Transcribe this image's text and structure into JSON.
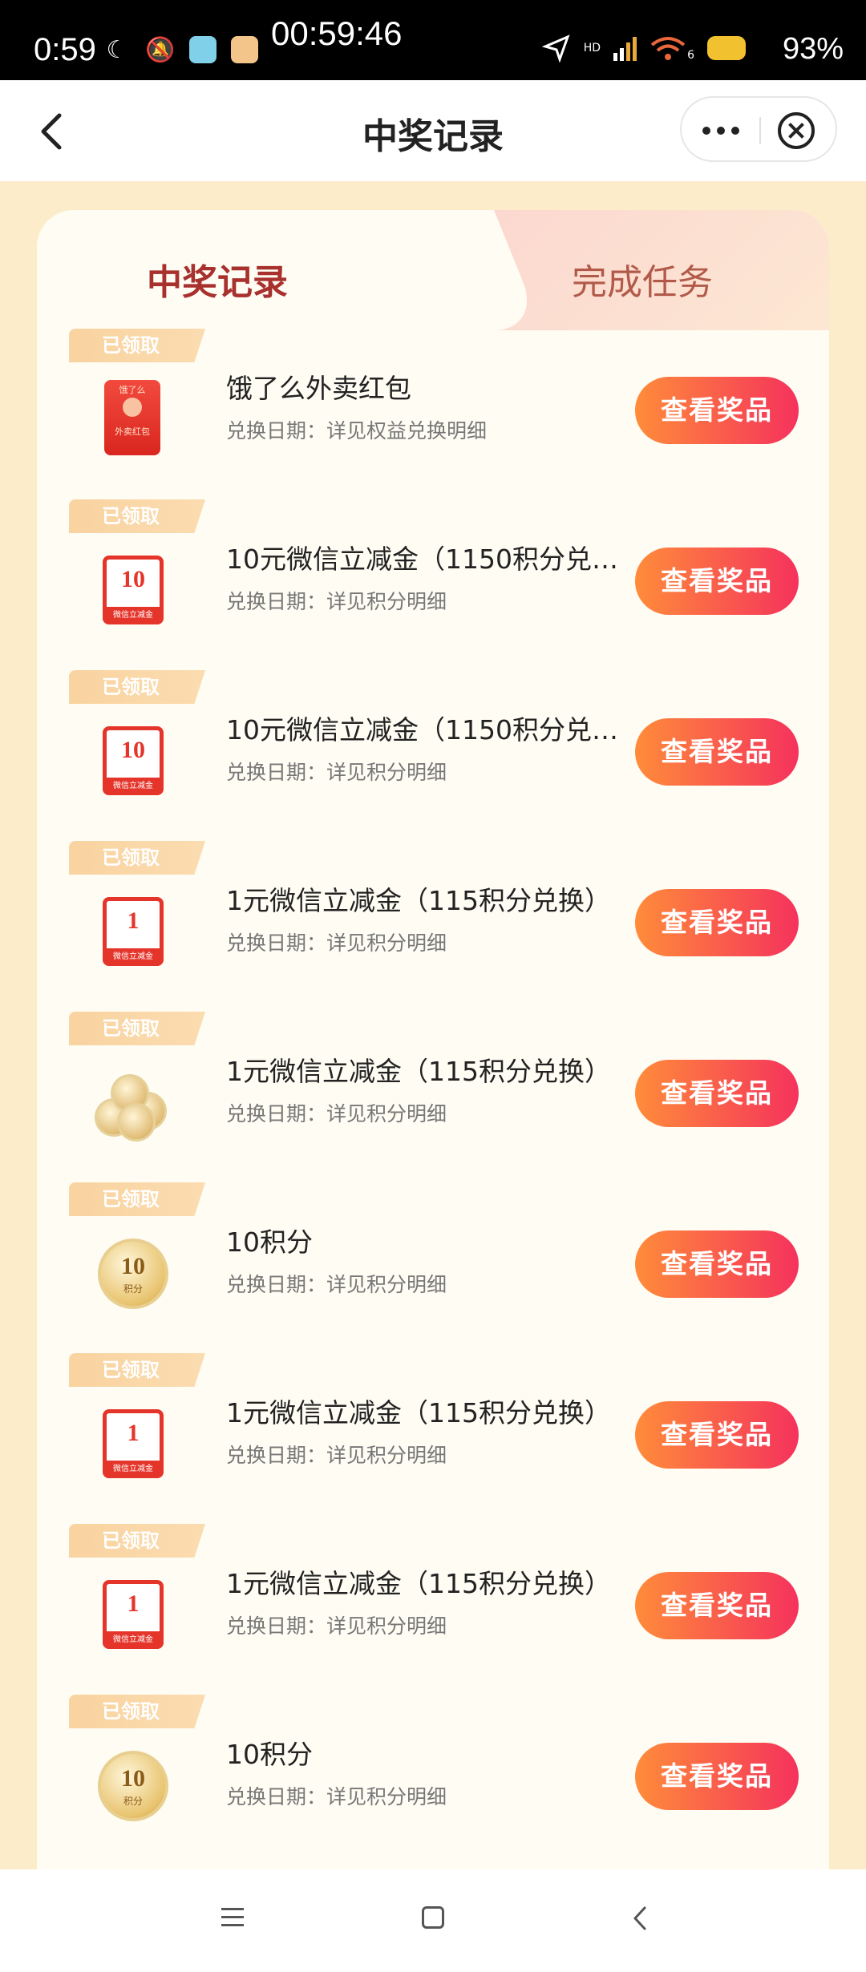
{
  "status_bar": {
    "time": "0:59",
    "center_time": "00:59:46",
    "network": "HD",
    "wifi_label": "6",
    "battery": "93%"
  },
  "nav": {
    "title": "中奖记录"
  },
  "tabs": [
    {
      "label": "中奖记录",
      "active": true
    },
    {
      "label": "完成任务",
      "active": false
    }
  ],
  "items": [
    {
      "badge": "已领取",
      "title": "饿了么外卖红包",
      "sub": "兑换日期：详见权益兑换明细",
      "button": "查看奖品",
      "thumb": "red-envelope-icon"
    },
    {
      "badge": "已领取",
      "title": "10元微信立减金（1150积分兑…",
      "sub": "兑换日期：详见积分明细",
      "button": "查看奖品",
      "thumb": "coupon-10-icon"
    },
    {
      "badge": "已领取",
      "title": "10元微信立减金（1150积分兑…",
      "sub": "兑换日期：详见积分明细",
      "button": "查看奖品",
      "thumb": "coupon-10-icon"
    },
    {
      "badge": "已领取",
      "title": "1元微信立减金（115积分兑换）",
      "sub": "兑换日期：详见积分明细",
      "button": "查看奖品",
      "thumb": "coupon-1-icon"
    },
    {
      "badge": "已领取",
      "title": "1元微信立减金（115积分兑换）",
      "sub": "兑换日期：详见积分明细",
      "button": "查看奖品",
      "thumb": "coin-stack-icon"
    },
    {
      "badge": "已领取",
      "title": "10积分",
      "sub": "兑换日期：详见积分明细",
      "button": "查看奖品",
      "thumb": "points-coin-icon"
    },
    {
      "badge": "已领取",
      "title": "1元微信立减金（115积分兑换）",
      "sub": "兑换日期：详见积分明细",
      "button": "查看奖品",
      "thumb": "coupon-1-icon"
    },
    {
      "badge": "已领取",
      "title": "1元微信立减金（115积分兑换）",
      "sub": "兑换日期：详见积分明细",
      "button": "查看奖品",
      "thumb": "coupon-1-icon"
    },
    {
      "badge": "已领取",
      "title": "10积分",
      "sub": "兑换日期：详见积分明细",
      "button": "查看奖品",
      "thumb": "points-coin-icon"
    }
  ],
  "thumb_text": {
    "eleme": "饿了么",
    "envelope": "外卖红包",
    "coupon_ten": "10",
    "coupon_one": "1",
    "coupon_foot": "微信立减金",
    "coin_ten": "10",
    "coin_sub": "积分"
  },
  "colors": {
    "accent_red": "#a8302d",
    "button_start": "#ff8c3a",
    "button_end": "#f5325c",
    "page_bg": "#fdecc9"
  }
}
